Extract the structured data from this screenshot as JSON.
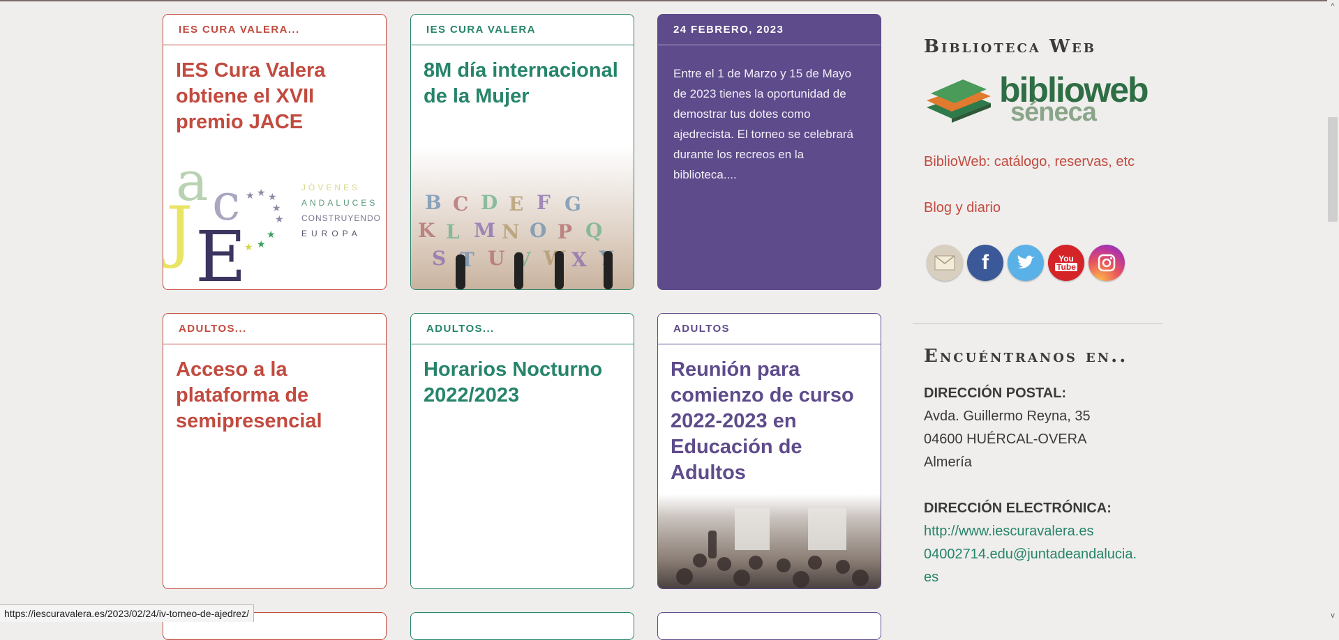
{
  "cards": [
    {
      "category": "IES CURA VALERA...",
      "title": "IES Cura Valera obtiene el XVII premio JACE",
      "image_label": "JACE logo",
      "jace_text": [
        "JÓVENES",
        "ANDALUCES",
        "CONSTRUYENDO",
        "EUROPA"
      ]
    },
    {
      "category": "IES CURA VALERA",
      "title": "8M día internacional de la Mujer",
      "image_label": "mural abecedario de mujeres"
    },
    {
      "category": "24 FEBRERO, 2023",
      "excerpt": "Entre el 1 de Marzo y 15 de Mayo de 2023 tienes la oportunidad de demostrar tus dotes como ajedrecista. El torneo se celebrará durante los recreos en la biblioteca...."
    },
    {
      "category": "ADULTOS...",
      "title": "Acceso a la plataforma de semipresencial"
    },
    {
      "category": "ADULTOS...",
      "title": "Horarios Nocturno 2022/2023"
    },
    {
      "category": "ADULTOS",
      "title": "Reunión para comienzo de curso 2022-2023 en Educación de Adultos",
      "image_label": "aula con alumnos"
    }
  ],
  "sidebar": {
    "biblioteca_title": "Biblioteca Web",
    "biblioweb_logo_top": "biblioweb",
    "biblioweb_logo_bottom": "séneca",
    "biblioweb_link": "BiblioWeb: catálogo, reservas, etc",
    "blog_link": "Blog y diario",
    "social": [
      "email-icon",
      "facebook-icon",
      "twitter-icon",
      "youtube-icon",
      "instagram-icon"
    ],
    "encuentranos_title": "Encuéntranos en..",
    "postal_label": "DIRECCIÓN POSTAL:",
    "postal_lines": [
      "Avda. Guillermo Reyna, 35",
      "04600 HUÉRCAL-OVERA",
      "Almería"
    ],
    "email_label": "DIRECCIÓN ELECTRÓNICA:",
    "web_link": "http://www.iescuravalera.es",
    "email_link_1": "04002714.edu@juntadeandalucia.",
    "email_link_2": "es"
  },
  "status_url": "https://iescuravalera.es/2023/02/24/iv-torneo-de-ajedrez/",
  "colors": {
    "red": "#c24a3f",
    "green": "#26846a",
    "purple": "#5e4b8b"
  }
}
